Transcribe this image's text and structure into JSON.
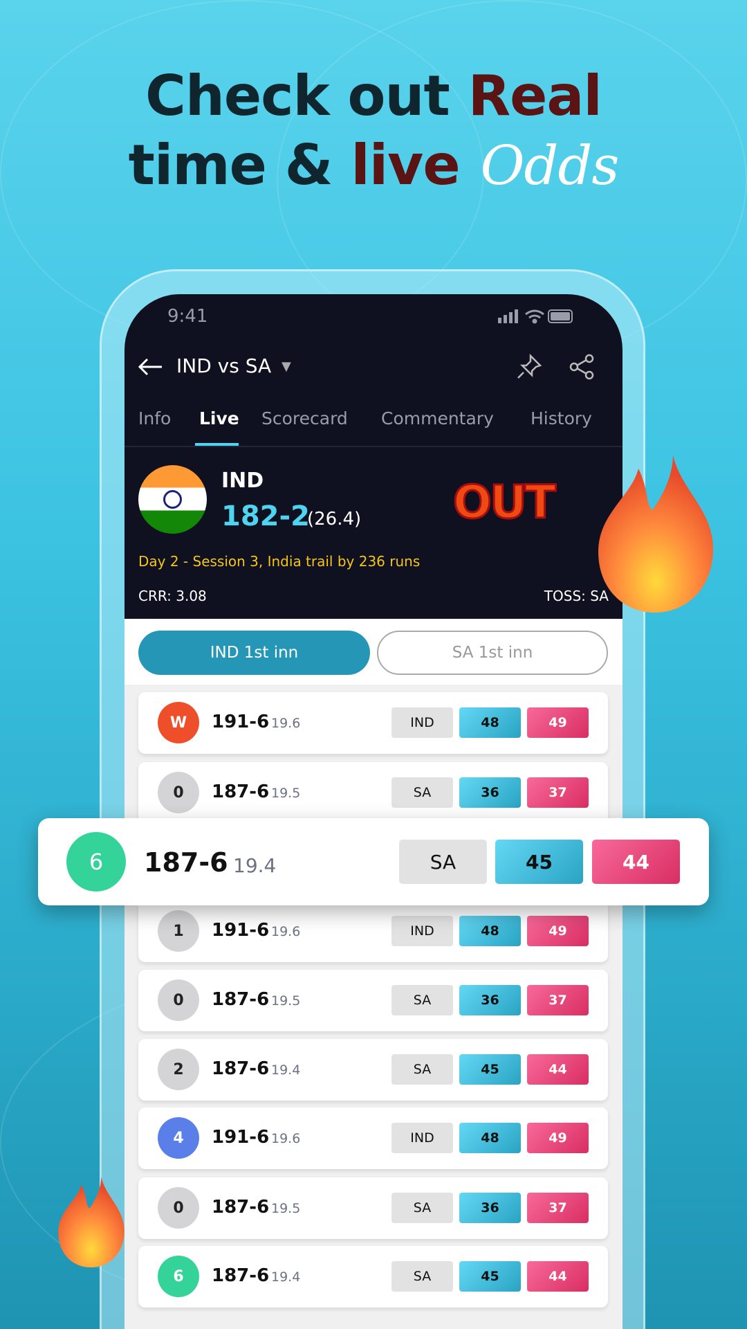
{
  "headline": {
    "line1_dark": "Check out ",
    "line1_red": "Real",
    "line2_dark": "time & ",
    "line2_red": "live",
    "script": "Odds"
  },
  "status": {
    "time": "9:41"
  },
  "header": {
    "title": "IND vs SA"
  },
  "tabs": [
    {
      "label": "Info"
    },
    {
      "label": "Live",
      "active": true
    },
    {
      "label": "Scorecard"
    },
    {
      "label": "Commentary"
    },
    {
      "label": "History"
    }
  ],
  "match": {
    "team": "IND",
    "score": "182-2",
    "overs": "(26.4)",
    "event": "OUT",
    "status": "Day 2 - Session 3, India trail by 236 runs",
    "crr": "CRR: 3.08",
    "toss": "TOSS: SA"
  },
  "innings": [
    {
      "label": "IND 1st inn",
      "active": true
    },
    {
      "label": "SA 1st inn"
    }
  ],
  "colors": {
    "accent": "#4dd4f0",
    "status_yellow": "#f5c518",
    "wicket": "#ee4e2a",
    "six": "#34d399",
    "four": "#5b7fe8",
    "dot": "#d4d4d6",
    "innings_active": "#2596b6"
  },
  "rows": [
    {
      "ball": "W",
      "score": "191-6",
      "over": "19.6",
      "team": "IND",
      "back": "48",
      "lay": "49",
      "type": "wicket"
    },
    {
      "ball": "0",
      "score": "187-6",
      "over": "19.5",
      "team": "SA",
      "back": "36",
      "lay": "37",
      "type": "dot"
    },
    {
      "ball": "1",
      "score": "191-6",
      "over": "19.6",
      "team": "IND",
      "back": "48",
      "lay": "49",
      "type": "dot"
    },
    {
      "ball": "0",
      "score": "187-6",
      "over": "19.5",
      "team": "SA",
      "back": "36",
      "lay": "37",
      "type": "dot"
    },
    {
      "ball": "2",
      "score": "187-6",
      "over": "19.4",
      "team": "SA",
      "back": "45",
      "lay": "44",
      "type": "dot"
    },
    {
      "ball": "4",
      "score": "191-6",
      "over": "19.6",
      "team": "IND",
      "back": "48",
      "lay": "49",
      "type": "four"
    },
    {
      "ball": "0",
      "score": "187-6",
      "over": "19.5",
      "team": "SA",
      "back": "36",
      "lay": "37",
      "type": "dot"
    },
    {
      "ball": "6",
      "score": "187-6",
      "over": "19.4",
      "team": "SA",
      "back": "45",
      "lay": "44",
      "type": "six"
    }
  ],
  "highlight": {
    "ball": "6",
    "score": "187-6",
    "over": "19.4",
    "team": "SA",
    "back": "45",
    "lay": "44",
    "type": "six"
  }
}
